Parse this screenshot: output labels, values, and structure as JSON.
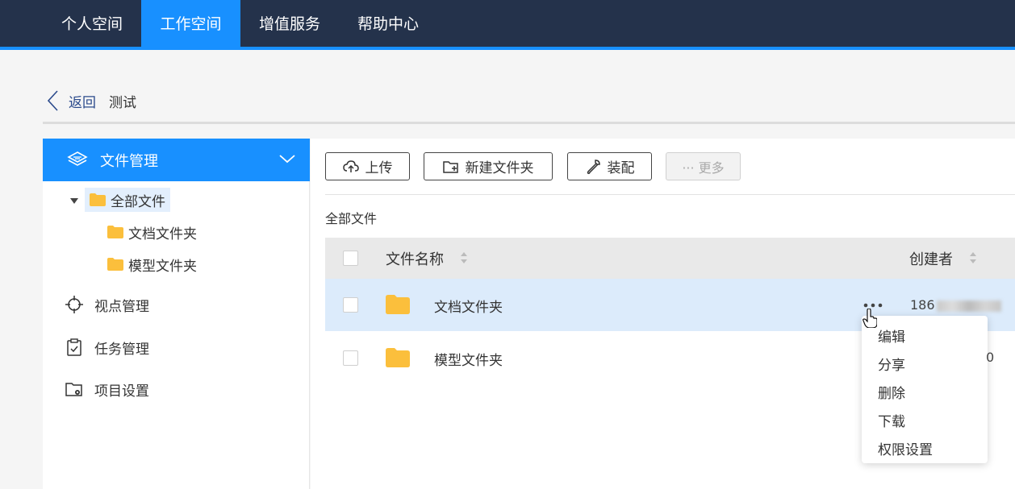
{
  "nav": {
    "tabs": [
      {
        "label": "个人空间",
        "active": false
      },
      {
        "label": "工作空间",
        "active": true
      },
      {
        "label": "增值服务",
        "active": false
      },
      {
        "label": "帮助中心",
        "active": false
      }
    ]
  },
  "breadcrumb": {
    "back_label": "返回",
    "current": "测试"
  },
  "sidebar": {
    "header_label": "文件管理",
    "tree": {
      "root": "全部文件",
      "children": [
        "文档文件夹",
        "模型文件夹"
      ]
    },
    "items": [
      {
        "label": "视点管理",
        "icon": "crosshair-icon"
      },
      {
        "label": "任务管理",
        "icon": "clipboard-check-icon"
      },
      {
        "label": "项目设置",
        "icon": "folder-settings-icon"
      }
    ]
  },
  "toolbar": {
    "upload_label": "上传",
    "new_folder_label": "新建文件夹",
    "assemble_label": "装配",
    "more_label": "··· 更多"
  },
  "path_label": "全部文件",
  "table": {
    "columns": [
      "文件名称",
      "创建者"
    ],
    "rows": [
      {
        "name": "文档文件夹",
        "creator": "186"
      },
      {
        "name": "模型文件夹",
        "creator": ""
      }
    ]
  },
  "context_menu": {
    "items": [
      "编辑",
      "分享",
      "删除",
      "下载",
      "权限设置"
    ]
  },
  "truncated_text": "0",
  "colors": {
    "nav_bg": "#24324b",
    "accent": "#1890ff",
    "folder": "#fbbf3c"
  }
}
